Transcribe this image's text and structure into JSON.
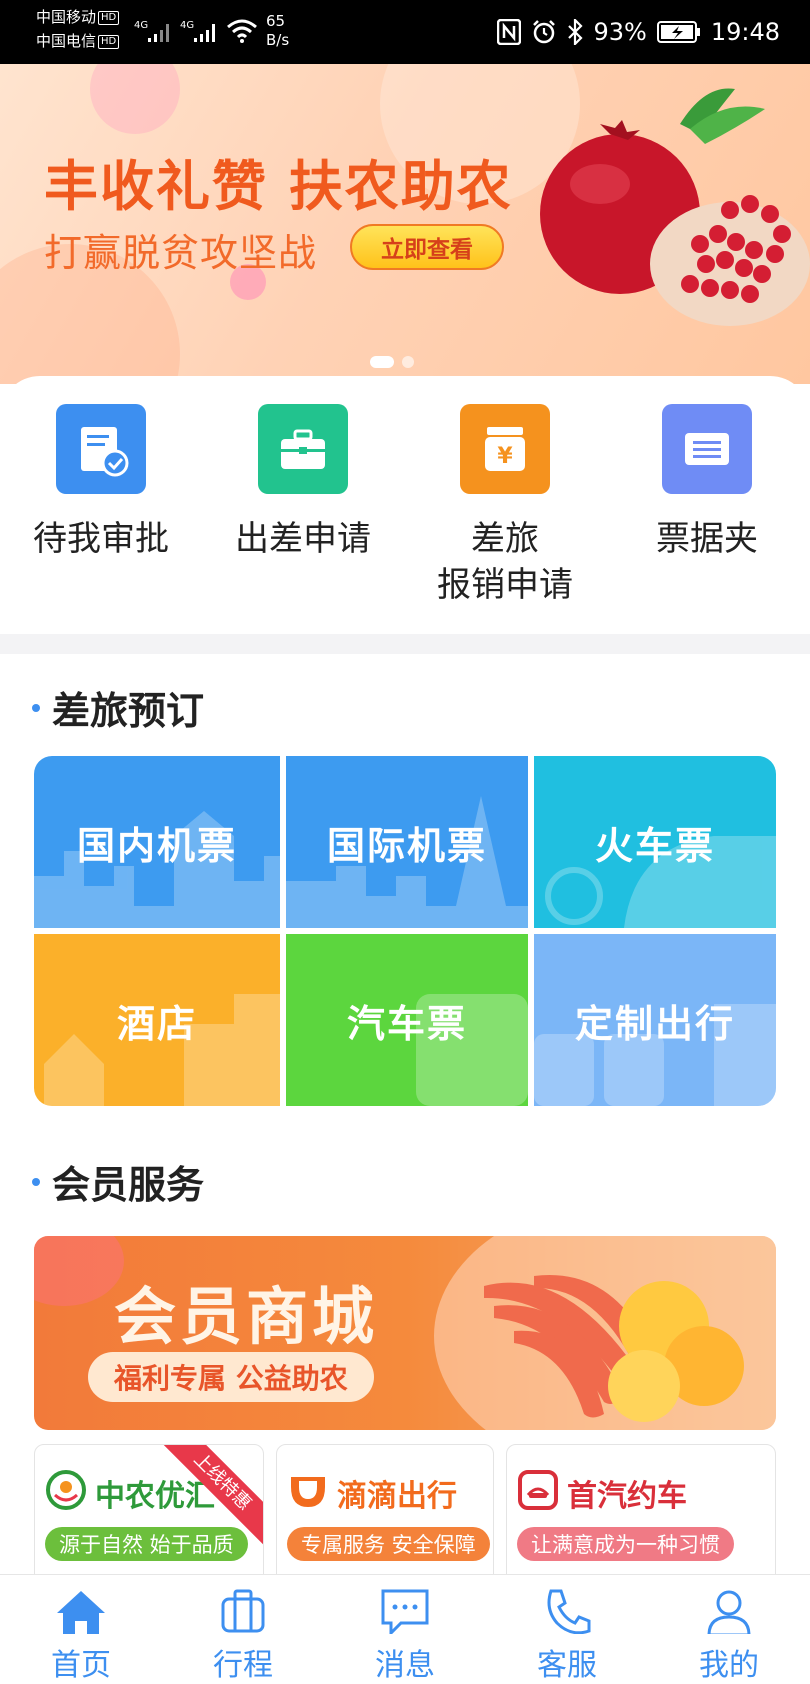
{
  "status_bar": {
    "carrier1": "中国移动",
    "carrier2": "中国电信",
    "hd": "HD",
    "net_type": "4G",
    "speed_value": "65",
    "speed_unit": "B/s",
    "nfc": "N",
    "battery": "93%",
    "time": "19:48"
  },
  "banner": {
    "title": "丰收礼赞  扶农助农",
    "subtitle": "打赢脱贫攻坚战",
    "button": "立即查看",
    "slides": 2,
    "active_slide": 1
  },
  "quick_actions": [
    {
      "label": "待我审批",
      "icon": "approval-doc-icon",
      "color": "#3d8ff0"
    },
    {
      "label": "出差申请",
      "icon": "briefcase-icon",
      "color": "#22c38e"
    },
    {
      "label": "差旅\n报销申请",
      "icon": "yen-jar-icon",
      "color": "#f5921e"
    },
    {
      "label": "票据夹",
      "icon": "ticket-folder-icon",
      "color": "#6f8cf5"
    }
  ],
  "booking": {
    "title": "差旅预订",
    "tiles": [
      {
        "label": "国内机票",
        "color": "#3d9bf0"
      },
      {
        "label": "国际机票",
        "color": "#3d9bf0"
      },
      {
        "label": "火车票",
        "color": "#20bfe0"
      },
      {
        "label": "酒店",
        "color": "#fbb02a"
      },
      {
        "label": "汽车票",
        "color": "#5cd63e"
      },
      {
        "label": "定制出行",
        "color": "#7bb6f7"
      }
    ]
  },
  "member": {
    "title": "会员服务",
    "mall_title": "会员商城",
    "mall_subtitle": "福利专属 公益助农",
    "partners": [
      {
        "name": "中农优汇",
        "tag": "源于自然 始于品质",
        "ribbon": "上线特惠",
        "name_color": "#2e9a3a",
        "tag_color": "#6cbf3c"
      },
      {
        "name": "滴滴出行",
        "tag": "专属服务 安全保障",
        "ribbon": "",
        "name_color": "#f26b1d",
        "tag_color": "#f4823a"
      },
      {
        "name": "首汽约车",
        "tag": "让满意成为一种习惯",
        "ribbon": "",
        "name_color": "#d92f3a",
        "tag_color": "#f07a85"
      }
    ]
  },
  "tabbar": [
    {
      "label": "首页",
      "icon": "home-icon",
      "active": true
    },
    {
      "label": "行程",
      "icon": "luggage-icon",
      "active": false
    },
    {
      "label": "消息",
      "icon": "message-icon",
      "active": false
    },
    {
      "label": "客服",
      "icon": "phone-icon",
      "active": false
    },
    {
      "label": "我的",
      "icon": "user-icon",
      "active": false
    }
  ]
}
